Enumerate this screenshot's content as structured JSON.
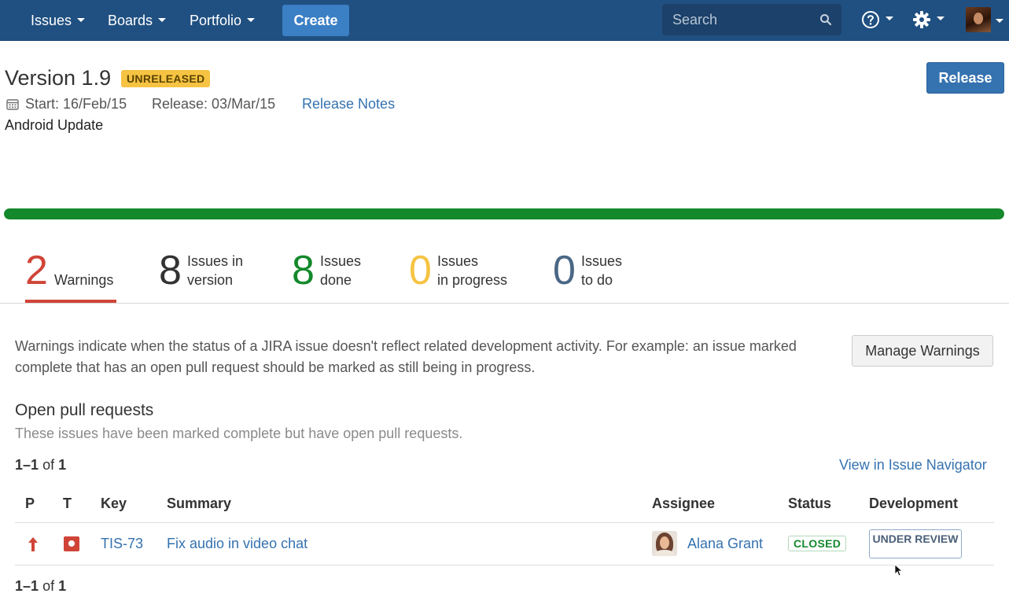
{
  "nav": {
    "issues": "Issues",
    "boards": "Boards",
    "portfolio": "Portfolio",
    "create": "Create",
    "search_placeholder": "Search"
  },
  "version": {
    "title": "Version 1.9",
    "status": "UNRELEASED",
    "start": "Start: 16/Feb/15",
    "release": "Release: 03/Mar/15",
    "release_notes": "Release Notes",
    "description": "Android Update",
    "release_button": "Release",
    "progress_percent": 100
  },
  "stats": {
    "warnings": {
      "num": "2",
      "label": "Warnings"
    },
    "in_version": {
      "num": "8",
      "label1": "Issues in",
      "label2": "version"
    },
    "done": {
      "num": "8",
      "label1": "Issues",
      "label2": "done"
    },
    "in_progress": {
      "num": "0",
      "label1": "Issues",
      "label2": "in progress"
    },
    "to_do": {
      "num": "0",
      "label1": "Issues",
      "label2": "to do"
    }
  },
  "warnings": {
    "text": "Warnings indicate when the status of a JIRA issue doesn't reflect related development activity. For example: an issue marked complete that has an open pull request should be marked as still being in progress.",
    "manage_button": "Manage Warnings",
    "section_title": "Open pull requests",
    "section_subtitle": "These issues have been marked complete but have open pull requests.",
    "pager_range": "1–1",
    "pager_of": "of",
    "pager_total": "1",
    "view_in_navigator": "View in Issue Navigator"
  },
  "table": {
    "headers": {
      "p": "P",
      "t": "T",
      "key": "Key",
      "summary": "Summary",
      "assignee": "Assignee",
      "status": "Status",
      "development": "Development"
    },
    "rows": [
      {
        "key": "TIS-73",
        "summary": "Fix audio in video chat",
        "assignee": "Alana Grant",
        "status": "CLOSED",
        "development": "UNDER REVIEW"
      }
    ]
  },
  "colors": {
    "nav_bg": "#205081",
    "warning_red": "#d04437",
    "done_green": "#14892c",
    "in_progress_yellow": "#f6c342",
    "to_do_blue": "#4a6785",
    "link_blue": "#3572b0"
  },
  "icons": {
    "search": "search-icon",
    "help": "help-icon",
    "settings": "gear-icon",
    "calendar": "calendar-icon",
    "priority": "priority-high-icon",
    "issue_type": "bug-icon"
  }
}
